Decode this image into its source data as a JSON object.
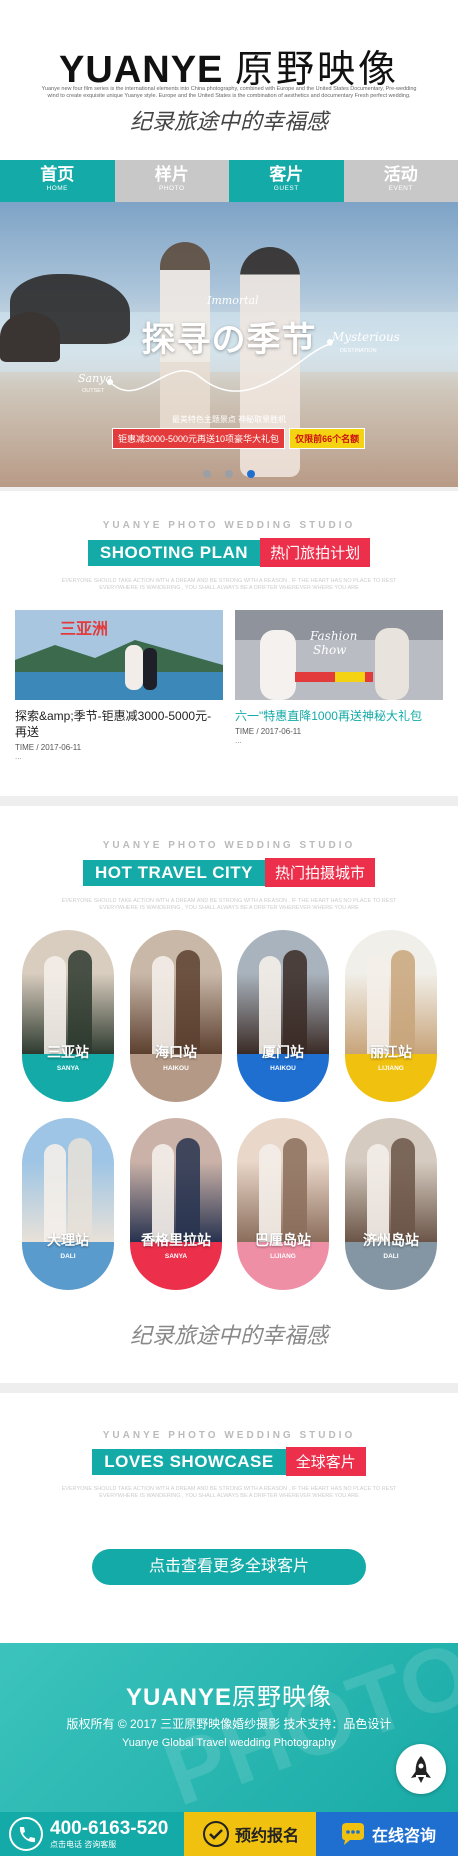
{
  "header": {
    "logo_en": "YUANYE",
    "logo_cn": "原野映像",
    "tagline": "Yuanye new four film series is the international elements into China photography, combined with Europe and the United States Documentary, Pre-wedding wind to create exquisite unique Yuanye style. Europe and the United States is the combination of aesthetics and documentary Fresh perfect wedding.",
    "signature": "纪录旅途中的幸福感"
  },
  "nav": [
    {
      "label": "首页",
      "sub": "HOME"
    },
    {
      "label": "样片",
      "sub": "PHOTO"
    },
    {
      "label": "客片",
      "sub": "GUEST"
    },
    {
      "label": "活动",
      "sub": "EVENT"
    }
  ],
  "banner": {
    "script_top": "Immortal",
    "title": "探寻の季节",
    "script_right": "Mysterious",
    "sub_right": "DESTINATION",
    "script_left": "Sanya",
    "sub_left": "OUTSET",
    "subtitle": "最美特色主题景点 神秘取景胜机",
    "badge_red": "钜惠减3000-5000元再送10项豪华大礼包",
    "badge_yellow": "仅限前66个名额",
    "active_slide": 3
  },
  "shooting": {
    "eyebrow": "YUANYE PHOTO WEDDING STUDIO",
    "title_en": "SHOOTING PLAN",
    "title_cn": "热门旅拍计划",
    "desc": "EVERYONE SHOULD TAKE ACTION WITH A DREAM AND BE STRONG WITH A REASON , IF THE HEART HAS NO PLACE TO REST EVERYWHERE IS WANDERING , YOU SHALL ALWAYS BE A DRIFTER WHEREVER WHERE YOU ARE",
    "cards": [
      {
        "title": "探索&amp;季节-钜惠减3000-5000元-再送",
        "time": "TIME / 2017-06-11",
        "more": "..."
      },
      {
        "title": "六一\"特惠直降1000再送神秘大礼包",
        "time": "TIME / 2017-06-11",
        "more": "..."
      }
    ]
  },
  "cities_section": {
    "eyebrow": "YUANYE PHOTO WEDDING STUDIO",
    "title_en": "HOT TRAVEL CITY",
    "title_cn": "热门拍摄城市",
    "desc": "EVERYONE SHOULD TAKE ACTION WITH A DREAM AND BE STRONG WITH A REASON , IF THE HEART HAS NO PLACE TO REST EVERYWHERE IS WANDERING , YOU SHALL ALWAYS BE A DRIFTER WHEREVER WHERE YOU ARE",
    "cities": [
      {
        "name": "三亚站",
        "en": "SANYA",
        "color": "#14aaa7"
      },
      {
        "name": "海口站",
        "en": "HAIKOU",
        "color": "#b49a86"
      },
      {
        "name": "厦门站",
        "en": "HAIKOU",
        "color": "#1f6fd1"
      },
      {
        "name": "丽江站",
        "en": "LIJIANG",
        "color": "#f1c10f"
      },
      {
        "name": "大理站",
        "en": "DALI",
        "color": "#5a9bcd"
      },
      {
        "name": "香格里拉站",
        "en": "SANYA",
        "color": "#ec2f4b"
      },
      {
        "name": "巴厘岛站",
        "en": "LIJIANG",
        "color": "#ee8fa6"
      },
      {
        "name": "济州岛站",
        "en": "DALI",
        "color": "#8496a4"
      }
    ],
    "signature": "纪录旅途中的幸福感"
  },
  "showcase": {
    "eyebrow": "YUANYE PHOTO WEDDING STUDIO",
    "title_en": "LOVES SHOWCASE",
    "title_cn": "全球客片",
    "desc": "EVERYONE SHOULD TAKE ACTION WITH A DREAM AND BE STRONG WITH A REASON , IF THE HEART HAS NO PLACE TO REST EVERYWHERE IS WANDERING , YOU SHALL ALWAYS BE A DRIFTER WHEREVER WHERE YOU ARE",
    "cta": "点击查看更多全球客片"
  },
  "footer": {
    "logo_en": "YUANYE",
    "logo_cn": "原野映像",
    "copyright": "版权所有 © 2017 三亚原野映像婚纱摄影 技术支持：品色设计",
    "en_line": "Yuanye Global Travel wedding Photography"
  },
  "bottom_bar": {
    "phone": "400-6163-520",
    "phone_sub": "点击电话 咨询客服",
    "signup": "预约报名",
    "chat": "在线咨询"
  },
  "colors": {
    "teal": "#14aaa7",
    "red": "#ec2f4b",
    "yellow": "#f1c10f",
    "blue": "#1f6fd1"
  }
}
